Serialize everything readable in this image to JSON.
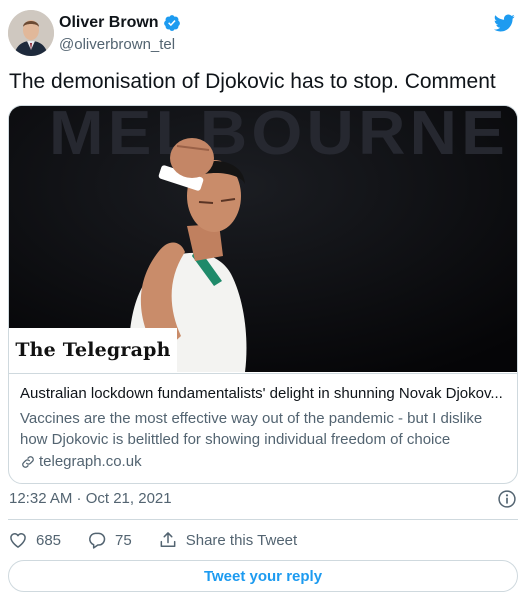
{
  "author": {
    "name": "Oliver Brown",
    "handle": "@oliverbrown_tel"
  },
  "tweet": {
    "text": "The demonisation of Djokovic has to stop. Comment",
    "timestamp": "12:32 AM · Oct 21, 2021"
  },
  "card": {
    "image_background_text": "MELBOURNE",
    "masthead": "The Telegraph",
    "title": "Australian lockdown fundamentalists' delight in shunning Novak Djokov...",
    "description": "Vaccines are the most effective way out of the pandemic - but I dislike how Djokovic is belittled for showing individual freedom of choice",
    "link": "telegraph.co.uk"
  },
  "actions": {
    "likes": "685",
    "replies": "75",
    "share_label": "Share this Tweet"
  },
  "reply_button": "Tweet your reply",
  "colors": {
    "accent": "#1d9bf0",
    "secondary_text": "#536471",
    "border": "#cfd9de"
  },
  "icons": [
    "verified-badge-icon",
    "twitter-bird-icon",
    "link-icon",
    "info-icon",
    "heart-icon",
    "reply-icon",
    "share-icon"
  ]
}
